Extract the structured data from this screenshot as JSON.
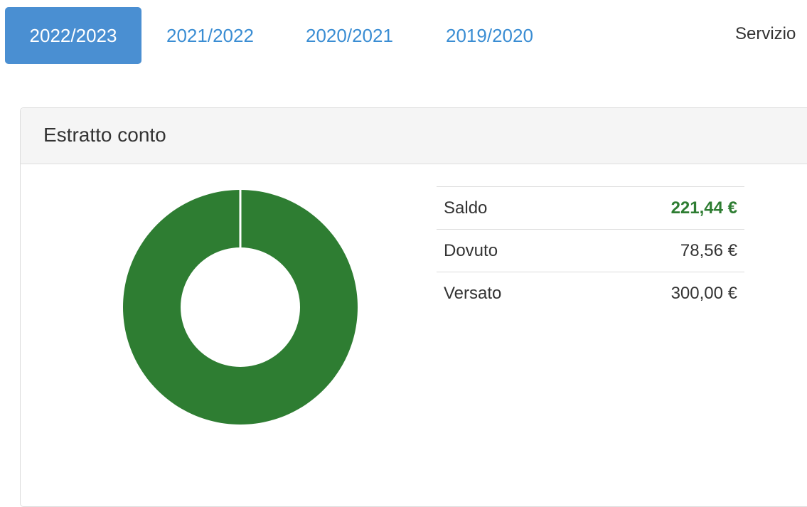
{
  "tabs": [
    {
      "label": "2022/2023",
      "active": true
    },
    {
      "label": "2021/2022",
      "active": false
    },
    {
      "label": "2020/2021",
      "active": false
    },
    {
      "label": "2019/2020",
      "active": false
    }
  ],
  "service_tab": {
    "label": "Servizio"
  },
  "panel": {
    "title": "Estratto conto",
    "summary": [
      {
        "label": "Saldo",
        "value": "221,44 €"
      },
      {
        "label": "Dovuto",
        "value": "78,56 €"
      },
      {
        "label": "Versato",
        "value": "300,00 €"
      }
    ]
  },
  "colors": {
    "accent": "#4a8fd2",
    "link": "#3a8dd3",
    "positive": "#2e7d32",
    "donut_fill": "#2e7d32"
  },
  "chart_data": {
    "type": "pie",
    "categories": [
      "Saldo",
      "Dovuto"
    ],
    "values": [
      221.44,
      0
    ],
    "colors": [
      "#2e7d32",
      "#ffffff"
    ],
    "title": ""
  }
}
